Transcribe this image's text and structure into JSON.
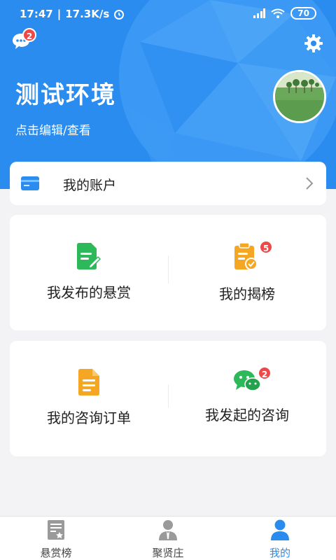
{
  "status_bar": {
    "time": "17:47",
    "speed": "17.3K/s",
    "battery": "70"
  },
  "header": {
    "title": "测试环境",
    "subtitle": "点击编辑/查看",
    "message_badge": "2"
  },
  "account": {
    "label": "我的账户"
  },
  "grid1": {
    "left_label": "我发布的悬赏",
    "right_label": "我的揭榜",
    "right_badge": "5"
  },
  "grid2": {
    "left_label": "我的咨询订单",
    "right_label": "我发起的咨询",
    "right_badge": "2"
  },
  "tabs": [
    {
      "label": "悬赏榜"
    },
    {
      "label": "聚贤庄"
    },
    {
      "label": "我的"
    }
  ],
  "colors": {
    "primary": "#2b8cf0",
    "green": "#2db85a",
    "orange": "#f5a623",
    "badge": "#f04848"
  }
}
